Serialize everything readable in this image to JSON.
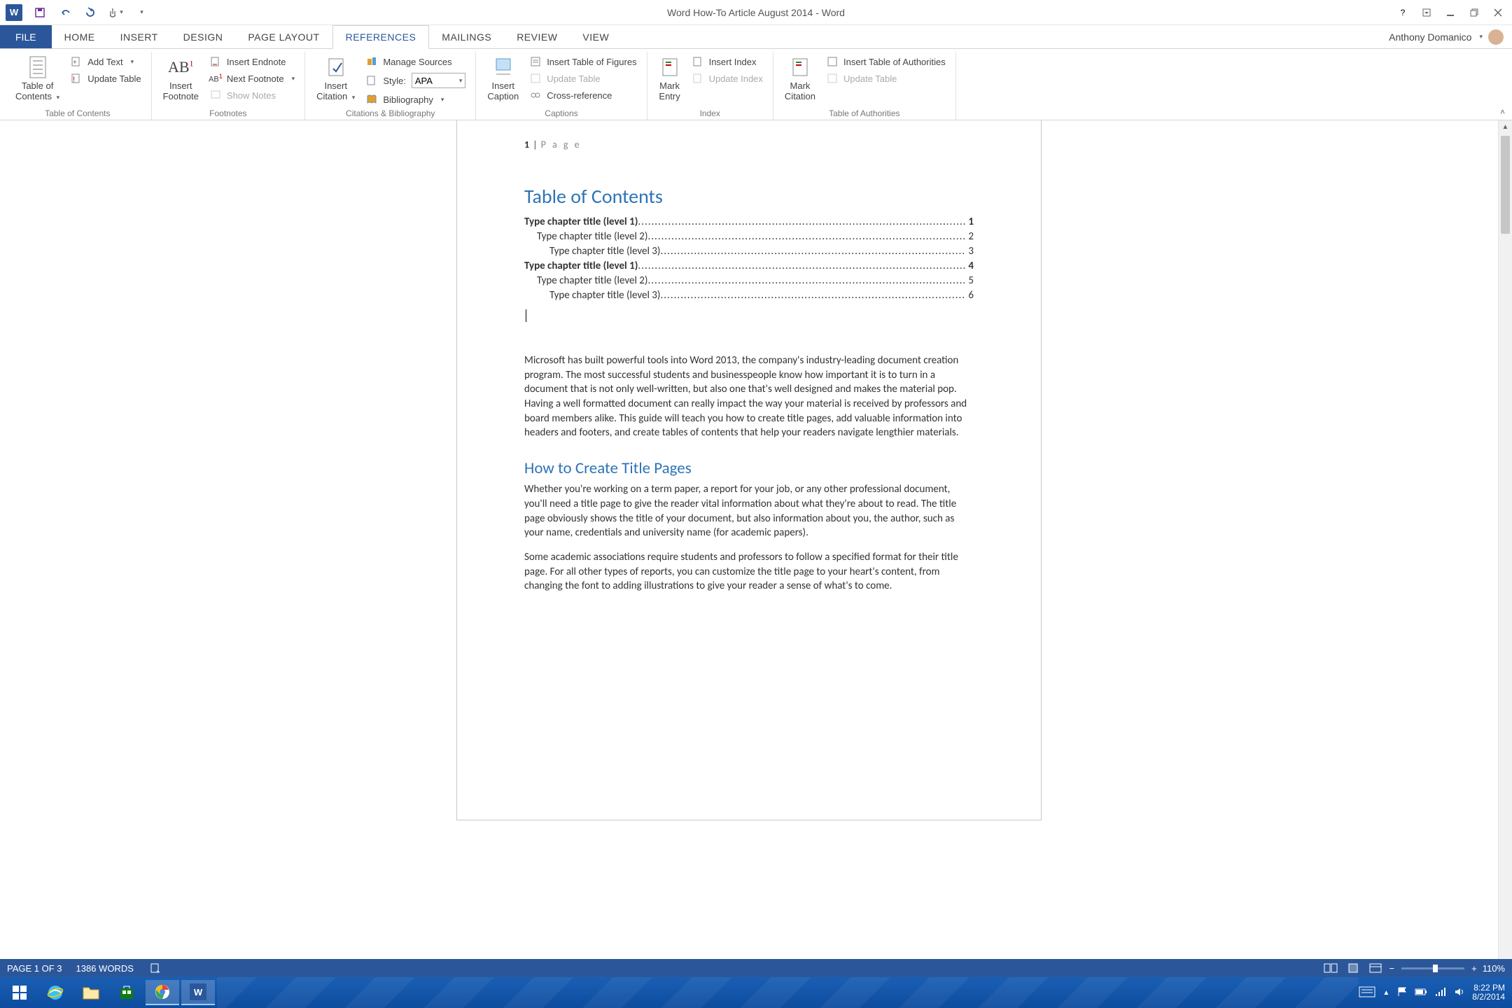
{
  "title": "Word How-To Article August 2014 - Word",
  "account": {
    "name": "Anthony Domanico"
  },
  "tabs": {
    "file": "FILE",
    "list": [
      "HOME",
      "INSERT",
      "DESIGN",
      "PAGE LAYOUT",
      "REFERENCES",
      "MAILINGS",
      "REVIEW",
      "VIEW"
    ],
    "activeIndex": 4
  },
  "ribbon": {
    "groups": {
      "toc": {
        "big": "Table of\nContents",
        "addText": "Add Text",
        "updateTable": "Update Table",
        "label": "Table of Contents"
      },
      "footnotes": {
        "big": "Insert\nFootnote",
        "insertEndnote": "Insert Endnote",
        "nextFootnote": "Next Footnote",
        "showNotes": "Show Notes",
        "label": "Footnotes"
      },
      "citations": {
        "big": "Insert\nCitation",
        "manageSources": "Manage Sources",
        "styleLabel": "Style:",
        "styleValue": "APA",
        "bibliography": "Bibliography",
        "label": "Citations & Bibliography"
      },
      "captions": {
        "big": "Insert\nCaption",
        "insertTof": "Insert Table of Figures",
        "updateTable": "Update Table",
        "crossRef": "Cross-reference",
        "label": "Captions"
      },
      "index": {
        "big": "Mark\nEntry",
        "insertIndex": "Insert Index",
        "updateIndex": "Update Index",
        "label": "Index"
      },
      "toa": {
        "big": "Mark\nCitation",
        "insertToa": "Insert Table of Authorities",
        "updateTable": "Update Table",
        "label": "Table of Authorities"
      }
    }
  },
  "document": {
    "pageHeader": {
      "num": "1",
      "label": "P a g e"
    },
    "tocHeading": "Table of Contents",
    "tocEntries": [
      {
        "level": 1,
        "title": "Type chapter title (level 1)",
        "page": "1"
      },
      {
        "level": 2,
        "title": "Type chapter title (level 2)",
        "page": "2"
      },
      {
        "level": 3,
        "title": "Type chapter title (level 3)",
        "page": "3"
      },
      {
        "level": 1,
        "title": "Type chapter title (level 1)",
        "page": "4"
      },
      {
        "level": 2,
        "title": "Type chapter title (level 2)",
        "page": "5"
      },
      {
        "level": 3,
        "title": "Type chapter title (level 3)",
        "page": "6"
      }
    ],
    "para1": "Microsoft has built powerful tools into Word 2013, the company's industry-leading document creation program. The most successful students and businesspeople know how important it is to turn in a document that is not only well-written, but also one that's well designed and makes the material pop. Having a well formatted document can really impact the way your material is received by professors and board members alike. This guide will teach you how to create title pages, add valuable information into headers and footers, and create tables of contents that help your readers navigate lengthier materials.",
    "heading2": "How to Create Title Pages",
    "para2": "Whether you're working on a term paper, a report for your job, or any other professional document, you'll need a title page to give the reader vital information about what they're about to read. The title page obviously shows the title of your document, but also information about you, the author, such as your name, credentials and university name (for academic papers).",
    "para3": "Some academic associations require students and professors to follow a specified format for their title page. For all other types of reports, you can customize the title page to your heart's content, from changing the font to adding illustrations to give your reader a sense of what's to come."
  },
  "status": {
    "page": "PAGE 1 OF 3",
    "words": "1386 WORDS",
    "zoom": "110%"
  },
  "tray": {
    "time": "8:22 PM",
    "date": "8/2/2014"
  }
}
